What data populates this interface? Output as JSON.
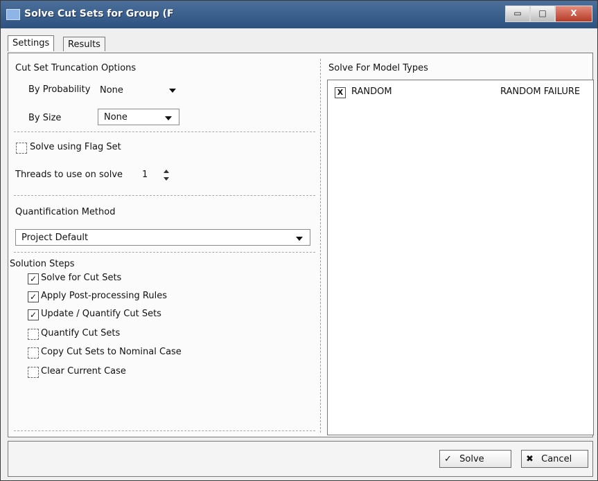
{
  "window": {
    "title": "Solve Cut Sets for Group (F"
  },
  "title_buttons": {
    "minimize": "▭",
    "maximize": "□",
    "close": "X"
  },
  "tabs": [
    {
      "label": "Settings",
      "active": true
    },
    {
      "label": "Results",
      "active": false
    }
  ],
  "truncation": {
    "section_title": "Cut Set Truncation Options",
    "by_probability_label": "By Probability",
    "by_probability_value": "None",
    "by_size_label": "By Size",
    "by_size_value": "None"
  },
  "flag_set": {
    "label": "Solve using Flag Set",
    "checked": false
  },
  "threads": {
    "label": "Threads to use on solve",
    "value": "1"
  },
  "quantification": {
    "section_title": "Quantification Method",
    "value": "Project Default"
  },
  "solution_steps": {
    "section_title": "Solution Steps",
    "items": [
      {
        "label": "Solve for Cut Sets",
        "checked": true
      },
      {
        "label": "Apply Post-processing Rules",
        "checked": true
      },
      {
        "label": "Update / Quantify Cut Sets",
        "checked": true
      },
      {
        "label": "Quantify Cut Sets",
        "checked": false
      },
      {
        "label": "Copy Cut Sets to Nominal Case",
        "checked": false
      },
      {
        "label": "Clear Current Case",
        "checked": false
      }
    ]
  },
  "model_types": {
    "section_title": "Solve For Model Types",
    "rows": [
      {
        "name": "RANDOM",
        "description": "RANDOM FAILURE",
        "checked": true
      }
    ]
  },
  "footer": {
    "solve_label": "Solve",
    "cancel_label": "Cancel"
  },
  "glyphs": {
    "check": "✓",
    "x": "X",
    "cancel_x": "✖"
  }
}
